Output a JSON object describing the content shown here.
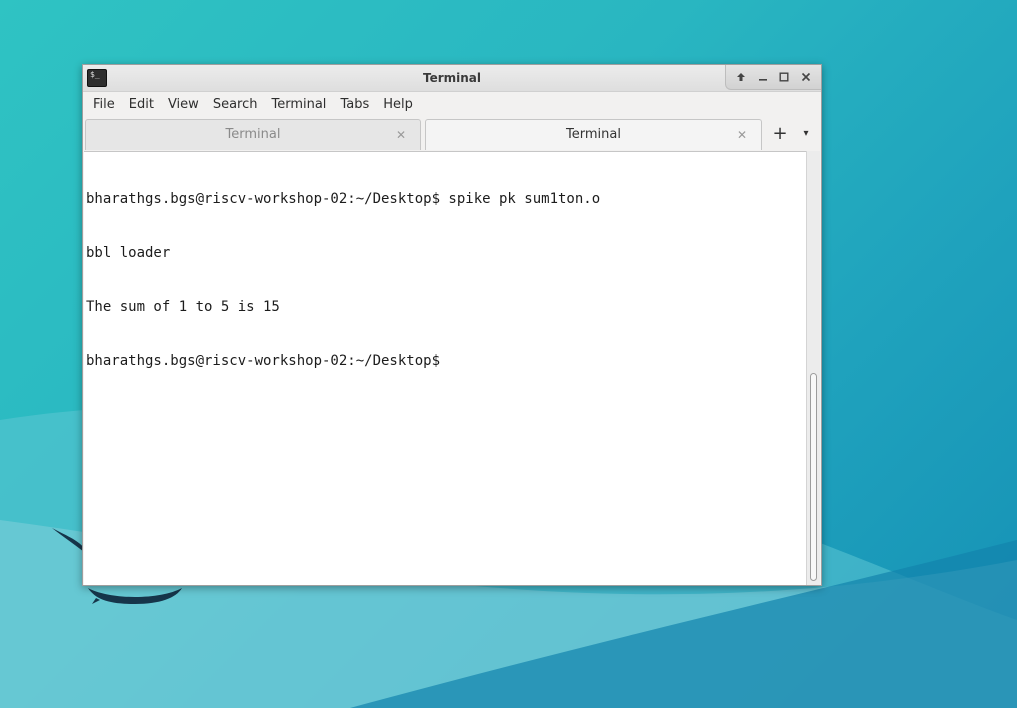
{
  "window": {
    "title": "Terminal",
    "controls": {
      "up_icon": "arrow-up-icon",
      "minimize_icon": "minimize-icon",
      "maximize_icon": "maximize-icon",
      "close_icon": "close-icon"
    }
  },
  "menubar": {
    "items": [
      "File",
      "Edit",
      "View",
      "Search",
      "Terminal",
      "Tabs",
      "Help"
    ]
  },
  "tabs": [
    {
      "label": "Terminal",
      "active": false
    },
    {
      "label": "Terminal",
      "active": true
    }
  ],
  "tab_actions": {
    "new_tab": "+",
    "menu": "▾"
  },
  "terminal": {
    "lines": [
      "bharathgs.bgs@riscv-workshop-02:~/Desktop$ spike pk sum1ton.o",
      "bbl loader",
      "The sum of 1 to 5 is 15",
      "bharathgs.bgs@riscv-workshop-02:~/Desktop$ "
    ]
  },
  "colors": {
    "desktop_accent": "#29b6c1",
    "terminal_bg": "#ffffff",
    "terminal_fg": "#1c1c1c"
  }
}
